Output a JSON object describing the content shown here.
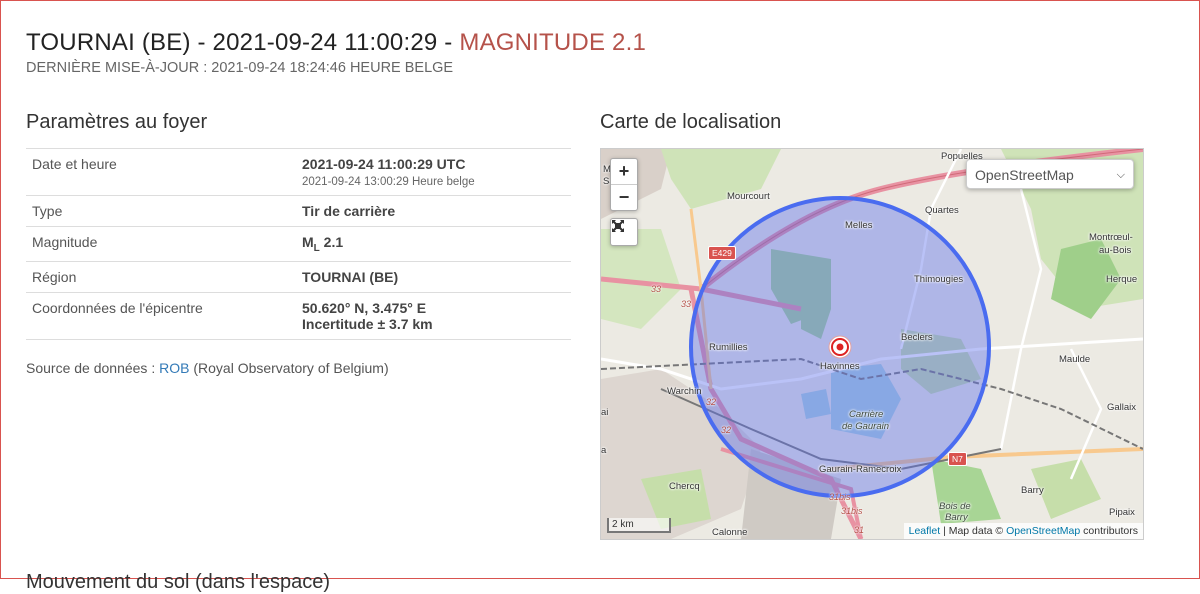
{
  "header": {
    "title": "TOURNAI (BE) - 2021-09-24 11:00:29 - ",
    "magnitude": "MAGNITUDE 2.1",
    "last_update": "DERNIÈRE MISE-À-JOUR : 2021-09-24 18:24:46 HEURE BELGE"
  },
  "params": {
    "heading": "Paramètres au foyer",
    "rows": [
      {
        "key": "Date et heure",
        "value": "2021-09-24 11:00:29 UTC",
        "sub": "2021-09-24 13:00:29 Heure belge"
      },
      {
        "key": "Type",
        "value": "Tir de carrière"
      },
      {
        "key": "Magnitude",
        "value_prefix": "M",
        "value_subscript": "L",
        "value_suffix": " 2.1"
      },
      {
        "key": "Région",
        "value": "TOURNAI (BE)"
      },
      {
        "key": "Coordonnées de l'épicentre",
        "value": "50.620° N, 3.475° E",
        "sub2": "Incertitude ± 3.7 km"
      }
    ],
    "source_prefix": "Source de données : ",
    "source_link": "ROB",
    "source_suffix": " (Royal Observatory of Belgium)"
  },
  "map": {
    "heading": "Carte de localisation",
    "zoom_in": "+",
    "zoom_out": "−",
    "layer": "OpenStreetMap",
    "scale": "2 km",
    "attribution_leaflet": "Leaflet",
    "attribution_mid": " | Map data © ",
    "attribution_osm": "OpenStreetMap",
    "attribution_end": " contributors",
    "uncertainty_radius_km": 3.7,
    "places": {
      "populles": "Popuelles",
      "mourcourt": "Mourcourt",
      "melles": "Melles",
      "quartes": "Quartes",
      "montroeul": "Montrœul-",
      "montroeul2": "au-Bois",
      "thimougies": "Thimougies",
      "herque": "Herque",
      "rumillies": "Rumillies",
      "beclers": "Beclers",
      "havinnes": "Havinnes",
      "maulde": "Maulde",
      "warchin": "Warchin",
      "gallaix": "Gallaix",
      "carriere": "Carrière",
      "carriere2": "de Gaurain",
      "gaurain": "Gaurain-Ramecroix",
      "chercq": "Chercq",
      "barry": "Barry",
      "bois": "Bois de",
      "bois2": "Barry",
      "pipaix": "Pipaix",
      "calonne": "Calonne",
      "mont": "Mont-",
      "mont2": "Saint-",
      "ai": "ai",
      "a": "a"
    },
    "roads": {
      "e429": "E429",
      "n7": "N7",
      "r33a": "33",
      "r33b": "33",
      "r32a": "32",
      "r32b": "32",
      "r31bis_a": "31bis",
      "r31bis_b": "31bis",
      "r31": "31"
    }
  },
  "footer_cut": "Mouvement du sol (dans l'espace)"
}
